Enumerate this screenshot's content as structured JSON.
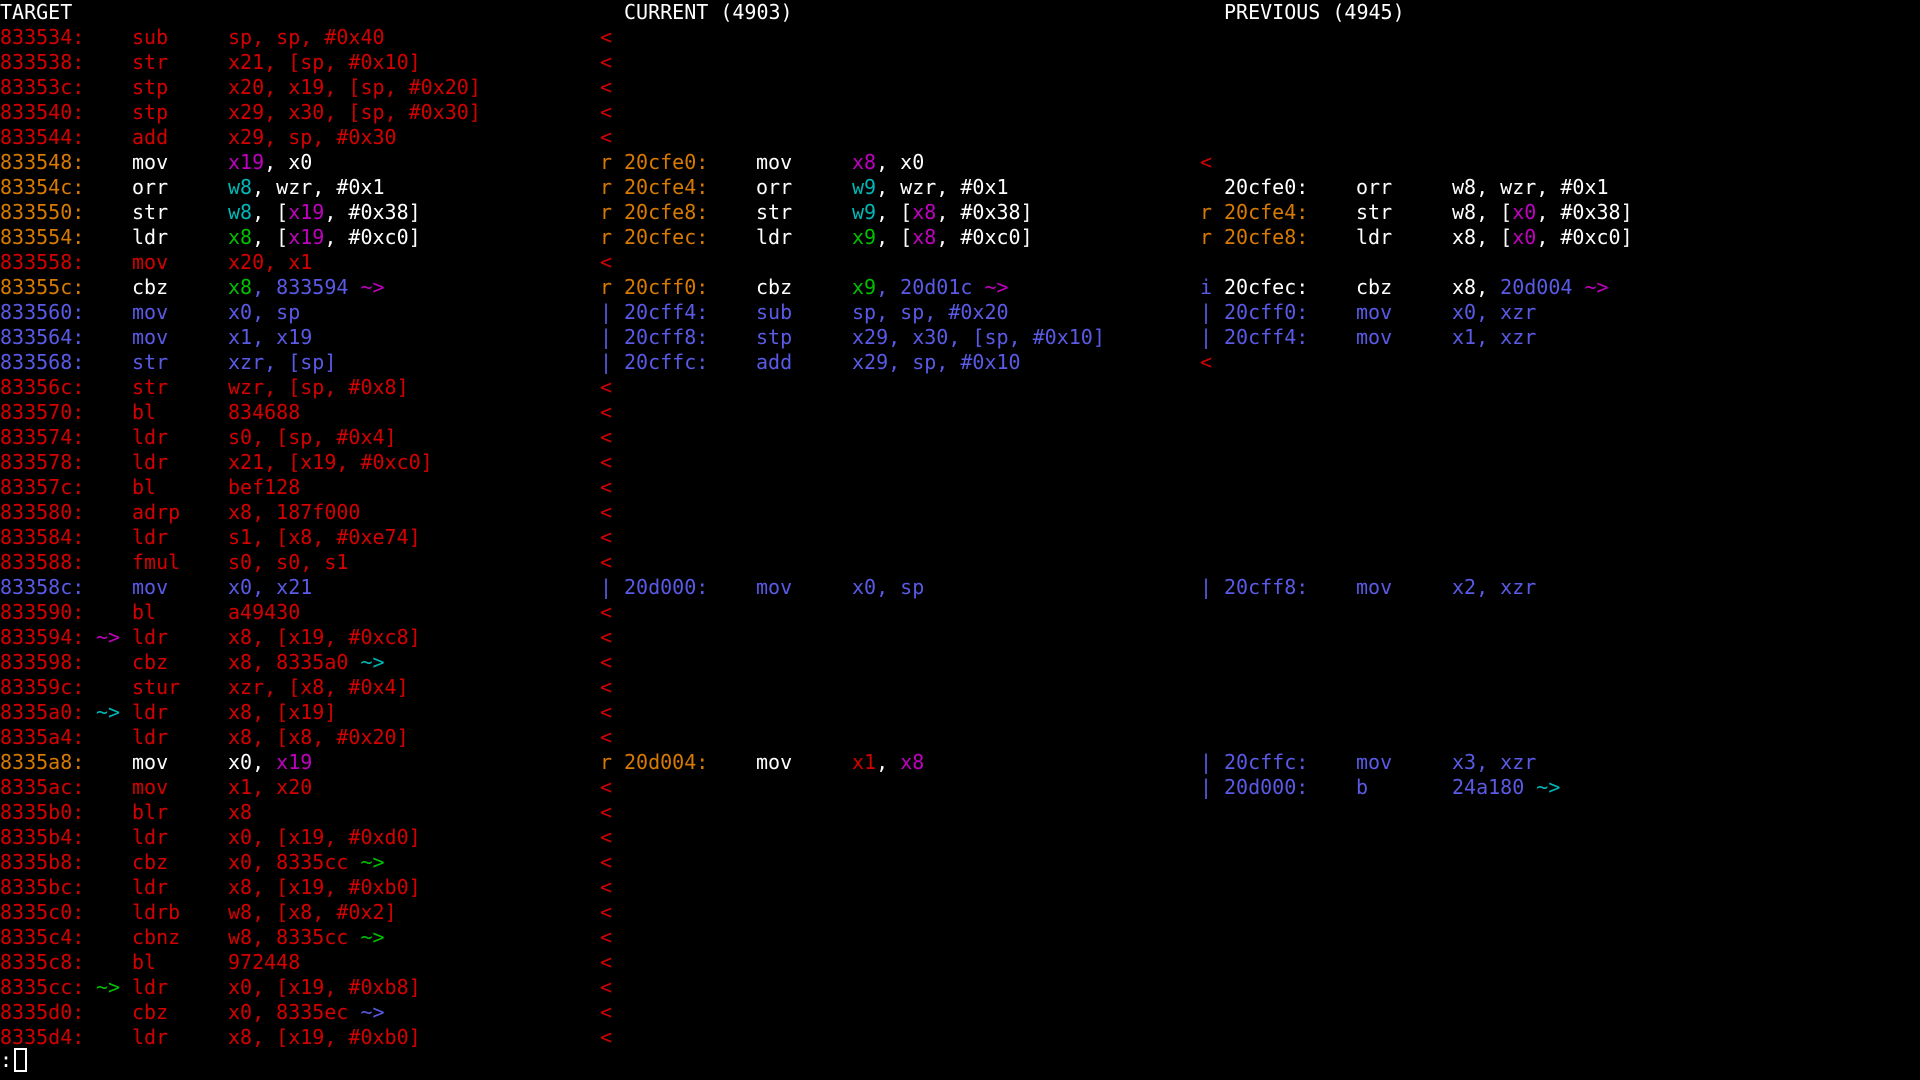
{
  "colors": {
    "red": "#d40000",
    "orange": "#d87a00",
    "white": "#ffffff",
    "blue": "#5a5ae6",
    "magenta": "#c000c0",
    "cyan": "#00b8b8",
    "green": "#00c000"
  },
  "headers": {
    "target": "TARGET",
    "current": "CURRENT (4903)",
    "previous": "PREVIOUS (4945)"
  },
  "target_rows": [
    {
      "addr": "833534:",
      "addr_c": "red",
      "arrow": "",
      "arrow_c": "red",
      "op": "sub",
      "op_c": "red",
      "args": [
        {
          "t": "sp, sp, #0x40",
          "c": "red"
        }
      ],
      "mark": "<",
      "mark_c": "red"
    },
    {
      "addr": "833538:",
      "addr_c": "red",
      "arrow": "",
      "arrow_c": "red",
      "op": "str",
      "op_c": "red",
      "args": [
        {
          "t": "x21, [sp, #0x10]",
          "c": "red"
        }
      ],
      "mark": "<",
      "mark_c": "red"
    },
    {
      "addr": "83353c:",
      "addr_c": "red",
      "arrow": "",
      "arrow_c": "red",
      "op": "stp",
      "op_c": "red",
      "args": [
        {
          "t": "x20, x19, [sp, #0x20]",
          "c": "red"
        }
      ],
      "mark": "<",
      "mark_c": "red"
    },
    {
      "addr": "833540:",
      "addr_c": "red",
      "arrow": "",
      "arrow_c": "red",
      "op": "stp",
      "op_c": "red",
      "args": [
        {
          "t": "x29, x30, [sp, #0x30]",
          "c": "red"
        }
      ],
      "mark": "<",
      "mark_c": "red"
    },
    {
      "addr": "833544:",
      "addr_c": "red",
      "arrow": "",
      "arrow_c": "red",
      "op": "add",
      "op_c": "red",
      "args": [
        {
          "t": "x29, sp, #0x30",
          "c": "red"
        }
      ],
      "mark": "<",
      "mark_c": "red"
    },
    {
      "addr": "833548:",
      "addr_c": "orange",
      "arrow": "",
      "arrow_c": "red",
      "op": "mov",
      "op_c": "white",
      "args": [
        {
          "t": "x19",
          "c": "magenta"
        },
        {
          "t": ", x0",
          "c": "white"
        }
      ],
      "mark": "r",
      "mark_c": "orange"
    },
    {
      "addr": "83354c:",
      "addr_c": "orange",
      "arrow": "",
      "arrow_c": "red",
      "op": "orr",
      "op_c": "white",
      "args": [
        {
          "t": "w8",
          "c": "cyan"
        },
        {
          "t": ", wzr, #0x1",
          "c": "white"
        }
      ],
      "mark": "r",
      "mark_c": "orange"
    },
    {
      "addr": "833550:",
      "addr_c": "orange",
      "arrow": "",
      "arrow_c": "red",
      "op": "str",
      "op_c": "white",
      "args": [
        {
          "t": "w8",
          "c": "cyan"
        },
        {
          "t": ", [",
          "c": "white"
        },
        {
          "t": "x19",
          "c": "magenta"
        },
        {
          "t": ", #0x38]",
          "c": "white"
        }
      ],
      "mark": "r",
      "mark_c": "orange"
    },
    {
      "addr": "833554:",
      "addr_c": "orange",
      "arrow": "",
      "arrow_c": "red",
      "op": "ldr",
      "op_c": "white",
      "args": [
        {
          "t": "x8",
          "c": "green"
        },
        {
          "t": ", [",
          "c": "white"
        },
        {
          "t": "x19",
          "c": "magenta"
        },
        {
          "t": ", #0xc0]",
          "c": "white"
        }
      ],
      "mark": "r",
      "mark_c": "orange"
    },
    {
      "addr": "833558:",
      "addr_c": "red",
      "arrow": "",
      "arrow_c": "red",
      "op": "mov",
      "op_c": "red",
      "args": [
        {
          "t": "x20, x1",
          "c": "red"
        }
      ],
      "mark": "<",
      "mark_c": "red"
    },
    {
      "addr": "83355c:",
      "addr_c": "orange",
      "arrow": "",
      "arrow_c": "red",
      "op": "cbz",
      "op_c": "white",
      "args": [
        {
          "t": "x8",
          "c": "green"
        },
        {
          "t": ", 833594 ",
          "c": "blue"
        },
        {
          "t": "~>",
          "c": "magenta"
        }
      ],
      "mark": "r",
      "mark_c": "orange"
    },
    {
      "addr": "833560:",
      "addr_c": "blue",
      "arrow": "",
      "arrow_c": "red",
      "op": "mov",
      "op_c": "blue",
      "args": [
        {
          "t": "x0, sp",
          "c": "blue"
        }
      ],
      "mark": "|",
      "mark_c": "blue"
    },
    {
      "addr": "833564:",
      "addr_c": "blue",
      "arrow": "",
      "arrow_c": "red",
      "op": "mov",
      "op_c": "blue",
      "args": [
        {
          "t": "x1, x19",
          "c": "blue"
        }
      ],
      "mark": "|",
      "mark_c": "blue"
    },
    {
      "addr": "833568:",
      "addr_c": "blue",
      "arrow": "",
      "arrow_c": "red",
      "op": "str",
      "op_c": "blue",
      "args": [
        {
          "t": "xzr, [sp]",
          "c": "blue"
        }
      ],
      "mark": "|",
      "mark_c": "blue"
    },
    {
      "addr": "83356c:",
      "addr_c": "red",
      "arrow": "",
      "arrow_c": "red",
      "op": "str",
      "op_c": "red",
      "args": [
        {
          "t": "wzr, [sp, #0x8]",
          "c": "red"
        }
      ],
      "mark": "<",
      "mark_c": "red"
    },
    {
      "addr": "833570:",
      "addr_c": "red",
      "arrow": "",
      "arrow_c": "red",
      "op": "bl",
      "op_c": "red",
      "args": [
        {
          "t": "834688",
          "c": "red"
        }
      ],
      "mark": "<",
      "mark_c": "red"
    },
    {
      "addr": "833574:",
      "addr_c": "red",
      "arrow": "",
      "arrow_c": "red",
      "op": "ldr",
      "op_c": "red",
      "args": [
        {
          "t": "s0, [sp, #0x4]",
          "c": "red"
        }
      ],
      "mark": "<",
      "mark_c": "red"
    },
    {
      "addr": "833578:",
      "addr_c": "red",
      "arrow": "",
      "arrow_c": "red",
      "op": "ldr",
      "op_c": "red",
      "args": [
        {
          "t": "x21, [x19, #0xc0]",
          "c": "red"
        }
      ],
      "mark": "<",
      "mark_c": "red"
    },
    {
      "addr": "83357c:",
      "addr_c": "red",
      "arrow": "",
      "arrow_c": "red",
      "op": "bl",
      "op_c": "red",
      "args": [
        {
          "t": "bef128",
          "c": "red"
        }
      ],
      "mark": "<",
      "mark_c": "red"
    },
    {
      "addr": "833580:",
      "addr_c": "red",
      "arrow": "",
      "arrow_c": "red",
      "op": "adrp",
      "op_c": "red",
      "args": [
        {
          "t": "x8, 187f000",
          "c": "red"
        }
      ],
      "mark": "<",
      "mark_c": "red"
    },
    {
      "addr": "833584:",
      "addr_c": "red",
      "arrow": "",
      "arrow_c": "red",
      "op": "ldr",
      "op_c": "red",
      "args": [
        {
          "t": "s1, [x8, #0xe74]",
          "c": "red"
        }
      ],
      "mark": "<",
      "mark_c": "red"
    },
    {
      "addr": "833588:",
      "addr_c": "red",
      "arrow": "",
      "arrow_c": "red",
      "op": "fmul",
      "op_c": "red",
      "args": [
        {
          "t": "s0, s0, s1",
          "c": "red"
        }
      ],
      "mark": "<",
      "mark_c": "red"
    },
    {
      "addr": "83358c:",
      "addr_c": "blue",
      "arrow": "",
      "arrow_c": "red",
      "op": "mov",
      "op_c": "blue",
      "args": [
        {
          "t": "x0, x21",
          "c": "blue"
        }
      ],
      "mark": "|",
      "mark_c": "blue"
    },
    {
      "addr": "833590:",
      "addr_c": "red",
      "arrow": "",
      "arrow_c": "red",
      "op": "bl",
      "op_c": "red",
      "args": [
        {
          "t": "a49430",
          "c": "red"
        }
      ],
      "mark": "<",
      "mark_c": "red"
    },
    {
      "addr": "833594:",
      "addr_c": "red",
      "arrow": "~>",
      "arrow_c": "magenta",
      "op": "ldr",
      "op_c": "red",
      "args": [
        {
          "t": "x8, [x19, #0xc8]",
          "c": "red"
        }
      ],
      "mark": "<",
      "mark_c": "red"
    },
    {
      "addr": "833598:",
      "addr_c": "red",
      "arrow": "",
      "arrow_c": "red",
      "op": "cbz",
      "op_c": "red",
      "args": [
        {
          "t": "x8, 8335a0 ",
          "c": "red"
        },
        {
          "t": "~>",
          "c": "cyan"
        }
      ],
      "mark": "<",
      "mark_c": "red"
    },
    {
      "addr": "83359c:",
      "addr_c": "red",
      "arrow": "",
      "arrow_c": "red",
      "op": "stur",
      "op_c": "red",
      "args": [
        {
          "t": "xzr, [x8, #0x4]",
          "c": "red"
        }
      ],
      "mark": "<",
      "mark_c": "red"
    },
    {
      "addr": "8335a0:",
      "addr_c": "red",
      "arrow": "~>",
      "arrow_c": "cyan",
      "op": "ldr",
      "op_c": "red",
      "args": [
        {
          "t": "x8, [x19]",
          "c": "red"
        }
      ],
      "mark": "<",
      "mark_c": "red"
    },
    {
      "addr": "8335a4:",
      "addr_c": "red",
      "arrow": "",
      "arrow_c": "red",
      "op": "ldr",
      "op_c": "red",
      "args": [
        {
          "t": "x8, [x8, #0x20]",
          "c": "red"
        }
      ],
      "mark": "<",
      "mark_c": "red"
    },
    {
      "addr": "8335a8:",
      "addr_c": "orange",
      "arrow": "",
      "arrow_c": "red",
      "op": "mov",
      "op_c": "white",
      "args": [
        {
          "t": "x0, ",
          "c": "white"
        },
        {
          "t": "x19",
          "c": "magenta"
        }
      ],
      "mark": "r",
      "mark_c": "orange"
    },
    {
      "addr": "8335ac:",
      "addr_c": "red",
      "arrow": "",
      "arrow_c": "red",
      "op": "mov",
      "op_c": "red",
      "args": [
        {
          "t": "x1, x20",
          "c": "red"
        }
      ],
      "mark": "<",
      "mark_c": "red"
    },
    {
      "addr": "8335b0:",
      "addr_c": "red",
      "arrow": "",
      "arrow_c": "red",
      "op": "blr",
      "op_c": "red",
      "args": [
        {
          "t": "x8",
          "c": "red"
        }
      ],
      "mark": "<",
      "mark_c": "red"
    },
    {
      "addr": "8335b4:",
      "addr_c": "red",
      "arrow": "",
      "arrow_c": "red",
      "op": "ldr",
      "op_c": "red",
      "args": [
        {
          "t": "x0, [x19, #0xd0]",
          "c": "red"
        }
      ],
      "mark": "<",
      "mark_c": "red"
    },
    {
      "addr": "8335b8:",
      "addr_c": "red",
      "arrow": "",
      "arrow_c": "red",
      "op": "cbz",
      "op_c": "red",
      "args": [
        {
          "t": "x0, 8335cc ",
          "c": "red"
        },
        {
          "t": "~>",
          "c": "green"
        }
      ],
      "mark": "<",
      "mark_c": "red"
    },
    {
      "addr": "8335bc:",
      "addr_c": "red",
      "arrow": "",
      "arrow_c": "red",
      "op": "ldr",
      "op_c": "red",
      "args": [
        {
          "t": "x8, [x19, #0xb0]",
          "c": "red"
        }
      ],
      "mark": "<",
      "mark_c": "red"
    },
    {
      "addr": "8335c0:",
      "addr_c": "red",
      "arrow": "",
      "arrow_c": "red",
      "op": "ldrb",
      "op_c": "red",
      "args": [
        {
          "t": "w8, [x8, #0x2]",
          "c": "red"
        }
      ],
      "mark": "<",
      "mark_c": "red"
    },
    {
      "addr": "8335c4:",
      "addr_c": "red",
      "arrow": "",
      "arrow_c": "red",
      "op": "cbnz",
      "op_c": "red",
      "args": [
        {
          "t": "w8, 8335cc ",
          "c": "red"
        },
        {
          "t": "~>",
          "c": "green"
        }
      ],
      "mark": "<",
      "mark_c": "red"
    },
    {
      "addr": "8335c8:",
      "addr_c": "red",
      "arrow": "",
      "arrow_c": "red",
      "op": "bl",
      "op_c": "red",
      "args": [
        {
          "t": "972448",
          "c": "red"
        }
      ],
      "mark": "<",
      "mark_c": "red"
    },
    {
      "addr": "8335cc:",
      "addr_c": "red",
      "arrow": "~>",
      "arrow_c": "green",
      "op": "ldr",
      "op_c": "red",
      "args": [
        {
          "t": "x0, [x19, #0xb8]",
          "c": "red"
        }
      ],
      "mark": "<",
      "mark_c": "red"
    },
    {
      "addr": "8335d0:",
      "addr_c": "red",
      "arrow": "",
      "arrow_c": "red",
      "op": "cbz",
      "op_c": "red",
      "args": [
        {
          "t": "x0, 8335ec ",
          "c": "red"
        },
        {
          "t": "~>",
          "c": "blue"
        }
      ],
      "mark": "<",
      "mark_c": "red"
    },
    {
      "addr": "8335d4:",
      "addr_c": "red",
      "arrow": "",
      "arrow_c": "red",
      "op": "ldr",
      "op_c": "red",
      "args": [
        {
          "t": "x8, [x19, #0xb0]",
          "c": "red"
        }
      ],
      "mark": "<",
      "mark_c": "red"
    }
  ],
  "current_rows": [
    {
      "row": 5,
      "mark": "",
      "mark_c": "red",
      "addr": "20cfe0:",
      "addr_c": "orange",
      "op": "mov",
      "op_c": "white",
      "args": [
        {
          "t": "x8",
          "c": "magenta"
        },
        {
          "t": ", x0",
          "c": "white"
        }
      ]
    },
    {
      "row": 6,
      "mark": "",
      "mark_c": "red",
      "addr": "20cfe4:",
      "addr_c": "orange",
      "op": "orr",
      "op_c": "white",
      "args": [
        {
          "t": "w9",
          "c": "cyan"
        },
        {
          "t": ", wzr, #0x1",
          "c": "white"
        }
      ]
    },
    {
      "row": 7,
      "mark": "",
      "mark_c": "red",
      "addr": "20cfe8:",
      "addr_c": "orange",
      "op": "str",
      "op_c": "white",
      "args": [
        {
          "t": "w9",
          "c": "cyan"
        },
        {
          "t": ", [",
          "c": "white"
        },
        {
          "t": "x8",
          "c": "magenta"
        },
        {
          "t": ", #0x38]",
          "c": "white"
        }
      ]
    },
    {
      "row": 8,
      "mark": "",
      "mark_c": "red",
      "addr": "20cfec:",
      "addr_c": "orange",
      "op": "ldr",
      "op_c": "white",
      "args": [
        {
          "t": "x9",
          "c": "green"
        },
        {
          "t": ", [",
          "c": "white"
        },
        {
          "t": "x8",
          "c": "magenta"
        },
        {
          "t": ", #0xc0]",
          "c": "white"
        }
      ]
    },
    {
      "row": 10,
      "mark": "",
      "mark_c": "red",
      "addr": "20cff0:",
      "addr_c": "orange",
      "op": "cbz",
      "op_c": "white",
      "args": [
        {
          "t": "x9",
          "c": "green"
        },
        {
          "t": ", 20d01c ",
          "c": "blue"
        },
        {
          "t": "~>",
          "c": "magenta"
        }
      ]
    },
    {
      "row": 11,
      "mark": "",
      "mark_c": "red",
      "addr": "20cff4:",
      "addr_c": "blue",
      "op": "sub",
      "op_c": "blue",
      "args": [
        {
          "t": "sp, sp, #0x20",
          "c": "blue"
        }
      ]
    },
    {
      "row": 12,
      "mark": "",
      "mark_c": "red",
      "addr": "20cff8:",
      "addr_c": "blue",
      "op": "stp",
      "op_c": "blue",
      "args": [
        {
          "t": "x29, x30, [sp, #0x10]",
          "c": "blue"
        }
      ]
    },
    {
      "row": 13,
      "mark": "",
      "mark_c": "red",
      "addr": "20cffc:",
      "addr_c": "blue",
      "op": "add",
      "op_c": "blue",
      "args": [
        {
          "t": "x29, sp, #0x10",
          "c": "blue"
        }
      ]
    },
    {
      "row": 22,
      "mark": "",
      "mark_c": "red",
      "addr": "20d000:",
      "addr_c": "blue",
      "op": "mov",
      "op_c": "blue",
      "args": [
        {
          "t": "x0, sp",
          "c": "blue"
        }
      ]
    },
    {
      "row": 29,
      "mark": "",
      "mark_c": "red",
      "addr": "20d004:",
      "addr_c": "orange",
      "op": "mov",
      "op_c": "white",
      "args": [
        {
          "t": "x1",
          "c": "red"
        },
        {
          "t": ", ",
          "c": "white"
        },
        {
          "t": "x8",
          "c": "magenta"
        }
      ]
    }
  ],
  "previous_rows": [
    {
      "row": 5,
      "mark": "<",
      "mark_c": "red",
      "addr": "",
      "addr_c": "white",
      "op": "",
      "op_c": "white",
      "args": []
    },
    {
      "row": 6,
      "mark": "",
      "mark_c": "white",
      "addr": "20cfe0:",
      "addr_c": "white",
      "op": "orr",
      "op_c": "white",
      "args": [
        {
          "t": "w8, wzr, #0x1",
          "c": "white"
        }
      ]
    },
    {
      "row": 7,
      "mark": "r",
      "mark_c": "orange",
      "addr": "20cfe4:",
      "addr_c": "orange",
      "op": "str",
      "op_c": "white",
      "args": [
        {
          "t": "w8, [",
          "c": "white"
        },
        {
          "t": "x0",
          "c": "magenta"
        },
        {
          "t": ", #0x38]",
          "c": "white"
        }
      ]
    },
    {
      "row": 8,
      "mark": "r",
      "mark_c": "orange",
      "addr": "20cfe8:",
      "addr_c": "orange",
      "op": "ldr",
      "op_c": "white",
      "args": [
        {
          "t": "x8, [",
          "c": "white"
        },
        {
          "t": "x0",
          "c": "magenta"
        },
        {
          "t": ", #0xc0]",
          "c": "white"
        }
      ]
    },
    {
      "row": 10,
      "mark": "i",
      "mark_c": "blue",
      "addr": "20cfec:",
      "addr_c": "white",
      "op": "cbz",
      "op_c": "white",
      "args": [
        {
          "t": "x8, ",
          "c": "white"
        },
        {
          "t": "20d004 ",
          "c": "blue"
        },
        {
          "t": "~>",
          "c": "magenta"
        }
      ]
    },
    {
      "row": 11,
      "mark": "|",
      "mark_c": "blue",
      "addr": "20cff0:",
      "addr_c": "blue",
      "op": "mov",
      "op_c": "blue",
      "args": [
        {
          "t": "x0, xzr",
          "c": "blue"
        }
      ]
    },
    {
      "row": 12,
      "mark": "|",
      "mark_c": "blue",
      "addr": "20cff4:",
      "addr_c": "blue",
      "op": "mov",
      "op_c": "blue",
      "args": [
        {
          "t": "x1, xzr",
          "c": "blue"
        }
      ]
    },
    {
      "row": 13,
      "mark": "<",
      "mark_c": "red",
      "addr": "",
      "addr_c": "white",
      "op": "",
      "op_c": "white",
      "args": []
    },
    {
      "row": 22,
      "mark": "|",
      "mark_c": "blue",
      "addr": "20cff8:",
      "addr_c": "blue",
      "op": "mov",
      "op_c": "blue",
      "args": [
        {
          "t": "x2, xzr",
          "c": "blue"
        }
      ]
    },
    {
      "row": 29,
      "mark": "|",
      "mark_c": "blue",
      "addr": "20cffc:",
      "addr_c": "blue",
      "op": "mov",
      "op_c": "blue",
      "args": [
        {
          "t": "x3, xzr",
          "c": "blue"
        }
      ]
    },
    {
      "row": 30,
      "mark": "|",
      "mark_c": "blue",
      "addr": "20d000:",
      "addr_c": "blue",
      "op": "b",
      "op_c": "blue",
      "args": [
        {
          "t": "24a180 ",
          "c": "blue"
        },
        {
          "t": "~>",
          "c": "cyan"
        }
      ]
    }
  ],
  "prompt": ":"
}
